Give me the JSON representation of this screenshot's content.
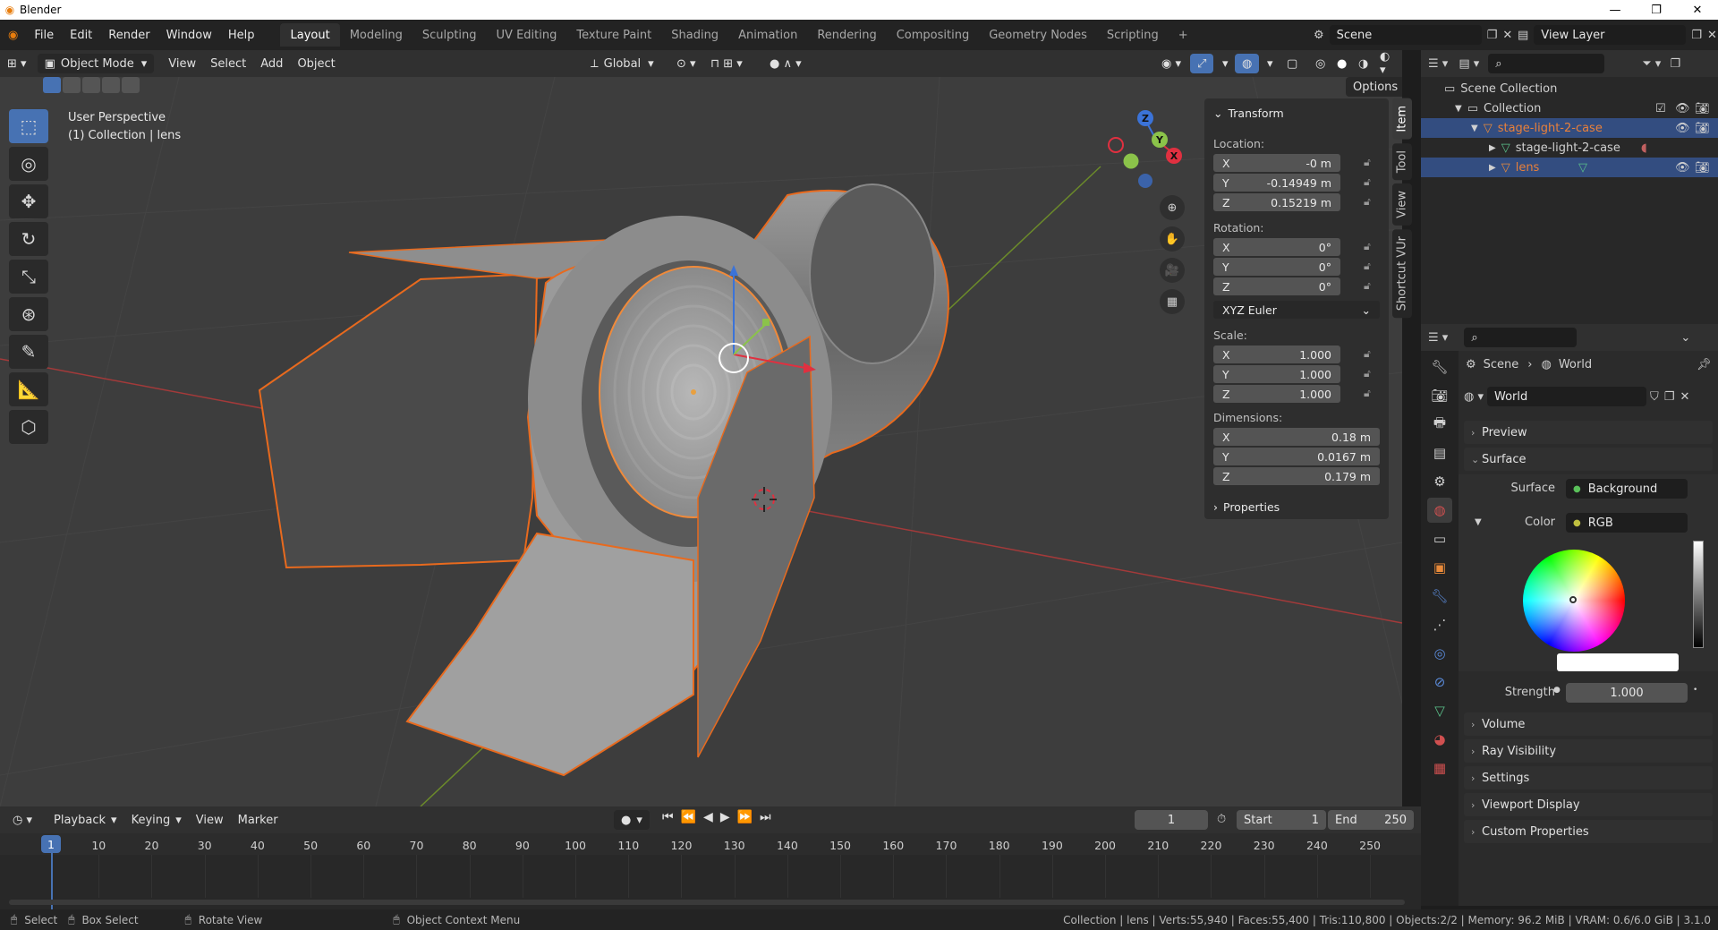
{
  "window": {
    "title": "Blender",
    "controls": [
      "—",
      "❐",
      "✕"
    ]
  },
  "menu": [
    "File",
    "Edit",
    "Render",
    "Window",
    "Help"
  ],
  "workspaces": [
    "Layout",
    "Modeling",
    "Sculpting",
    "UV Editing",
    "Texture Paint",
    "Shading",
    "Animation",
    "Rendering",
    "Compositing",
    "Geometry Nodes",
    "Scripting",
    "+"
  ],
  "active_workspace": "Layout",
  "scene_name": "Scene",
  "view_layer": "View Layer",
  "viewport_header": {
    "mode": "Object Mode",
    "menus": [
      "View",
      "Select",
      "Add",
      "Object"
    ],
    "orientation": "Global",
    "options": "Options"
  },
  "viewport": {
    "perspective": "User Perspective",
    "collection_info": "(1) Collection | lens"
  },
  "npanel": {
    "transform_title": "Transform",
    "location_label": "Location:",
    "location": [
      {
        "axis": "X",
        "value": "-0 m"
      },
      {
        "axis": "Y",
        "value": "-0.14949 m"
      },
      {
        "axis": "Z",
        "value": "0.15219 m"
      }
    ],
    "rotation_label": "Rotation:",
    "rotation": [
      {
        "axis": "X",
        "value": "0°"
      },
      {
        "axis": "Y",
        "value": "0°"
      },
      {
        "axis": "Z",
        "value": "0°"
      }
    ],
    "rotation_mode": "XYZ Euler",
    "scale_label": "Scale:",
    "scale": [
      {
        "axis": "X",
        "value": "1.000"
      },
      {
        "axis": "Y",
        "value": "1.000"
      },
      {
        "axis": "Z",
        "value": "1.000"
      }
    ],
    "dimensions_label": "Dimensions:",
    "dimensions": [
      {
        "axis": "X",
        "value": "0.18 m"
      },
      {
        "axis": "Y",
        "value": "0.0167 m"
      },
      {
        "axis": "Z",
        "value": "0.179 m"
      }
    ],
    "properties_label": "Properties",
    "tabs": [
      "Item",
      "Tool",
      "View",
      "Shortcut VUr"
    ]
  },
  "outliner": {
    "root": "Scene Collection",
    "collection": "Collection",
    "items": [
      {
        "name": "stage-light-2-case",
        "selected": true
      },
      {
        "name": "stage-light-2-case",
        "selected": false
      },
      {
        "name": "lens",
        "selected": true
      }
    ]
  },
  "properties": {
    "breadcrumb_scene": "Scene",
    "breadcrumb_world": "World",
    "world_name": "World",
    "sections_top": [
      "Preview",
      "Surface"
    ],
    "surface_label": "Surface",
    "surface_value": "Background",
    "color_label": "Color",
    "color_value": "RGB",
    "strength_label": "Strength",
    "strength_value": "1.000",
    "sections_bottom": [
      "Volume",
      "Ray Visibility",
      "Settings",
      "Viewport Display",
      "Custom Properties"
    ]
  },
  "timeline": {
    "menus": [
      "Playback",
      "Keying",
      "View",
      "Marker"
    ],
    "current_frame": "1",
    "start_label": "Start",
    "start": "1",
    "end_label": "End",
    "end": "250",
    "ticks": [
      "1",
      "10",
      "20",
      "30",
      "40",
      "50",
      "60",
      "70",
      "80",
      "90",
      "100",
      "110",
      "120",
      "130",
      "140",
      "150",
      "160",
      "170",
      "180",
      "190",
      "200",
      "210",
      "220",
      "230",
      "240",
      "250"
    ]
  },
  "statusbar": {
    "select": "Select",
    "box_select": "Box Select",
    "rotate_view": "Rotate View",
    "context_menu": "Object Context Menu",
    "stats": "Collection | lens | Verts:55,940 | Faces:55,400 | Tris:110,800 | Objects:2/2 | Memory: 96.2 MiB | VRAM: 0.6/6.0 GiB | 3.1.0"
  },
  "colors": {
    "accent": "#4772b3",
    "selection": "#e86a1e",
    "background": "#3d3d3d"
  }
}
